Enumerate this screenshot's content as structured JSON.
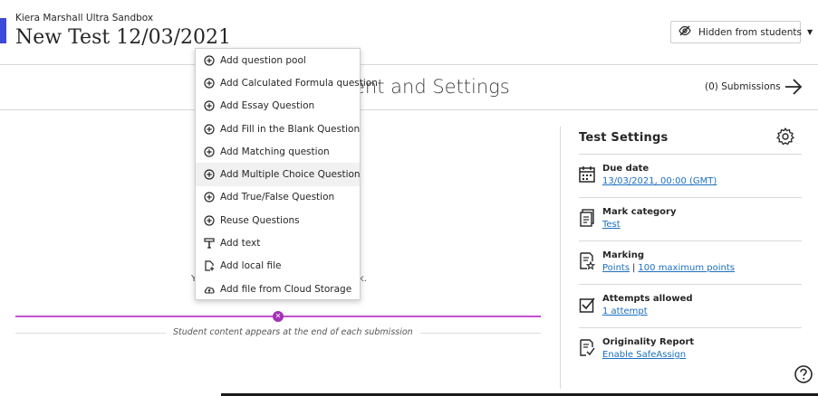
{
  "header": {
    "course_name": "Kiera Marshall Ultra Sandbox",
    "test_title": "New Test 12/03/2021",
    "visibility_label": "Hidden from students",
    "accent_color": "#3b4ad8"
  },
  "content_bar": {
    "heading": "ent and Settings",
    "submissions": "(0) Submissions"
  },
  "add_menu": {
    "items": [
      {
        "label": "Add question pool",
        "icon": "plus-circle-icon"
      },
      {
        "label": "Add Calculated Formula question",
        "icon": "plus-circle-icon"
      },
      {
        "label": "Add Essay Question",
        "icon": "plus-circle-icon"
      },
      {
        "label": "Add Fill in the Blank Question",
        "icon": "plus-circle-icon"
      },
      {
        "label": "Add Matching question",
        "icon": "plus-circle-icon"
      },
      {
        "label": "Add Multiple Choice Question",
        "icon": "plus-circle-icon",
        "highlighted": true
      },
      {
        "label": "Add True/False Question",
        "icon": "plus-circle-icon"
      },
      {
        "label": "Reuse Questions",
        "icon": "plus-circle-icon"
      },
      {
        "label": "Add text",
        "icon": "text-icon"
      },
      {
        "label": "Add local file",
        "icon": "file-upload-icon"
      },
      {
        "label": "Add file from Cloud Storage",
        "icon": "cloud-upload-icon"
      }
    ]
  },
  "content_area": {
    "hidden_left": "Y",
    "hidden_right": "k.",
    "student_note": "Student content appears at the end of each submission",
    "divider_color": "#c64fd4"
  },
  "settings": {
    "title": "Test Settings",
    "due_date": {
      "label": "Due date",
      "value": "13/03/2021, 00:00 (GMT)"
    },
    "mark_category": {
      "label": "Mark category",
      "value": "Test"
    },
    "marking": {
      "label": "Marking",
      "value_a": "Points",
      "separator": "|",
      "value_b": "100 maximum points"
    },
    "attempts": {
      "label": "Attempts allowed",
      "value": "1 attempt"
    },
    "originality": {
      "label": "Originality Report",
      "value": "Enable SafeAssign"
    },
    "link_color": "#1b6fbf"
  }
}
